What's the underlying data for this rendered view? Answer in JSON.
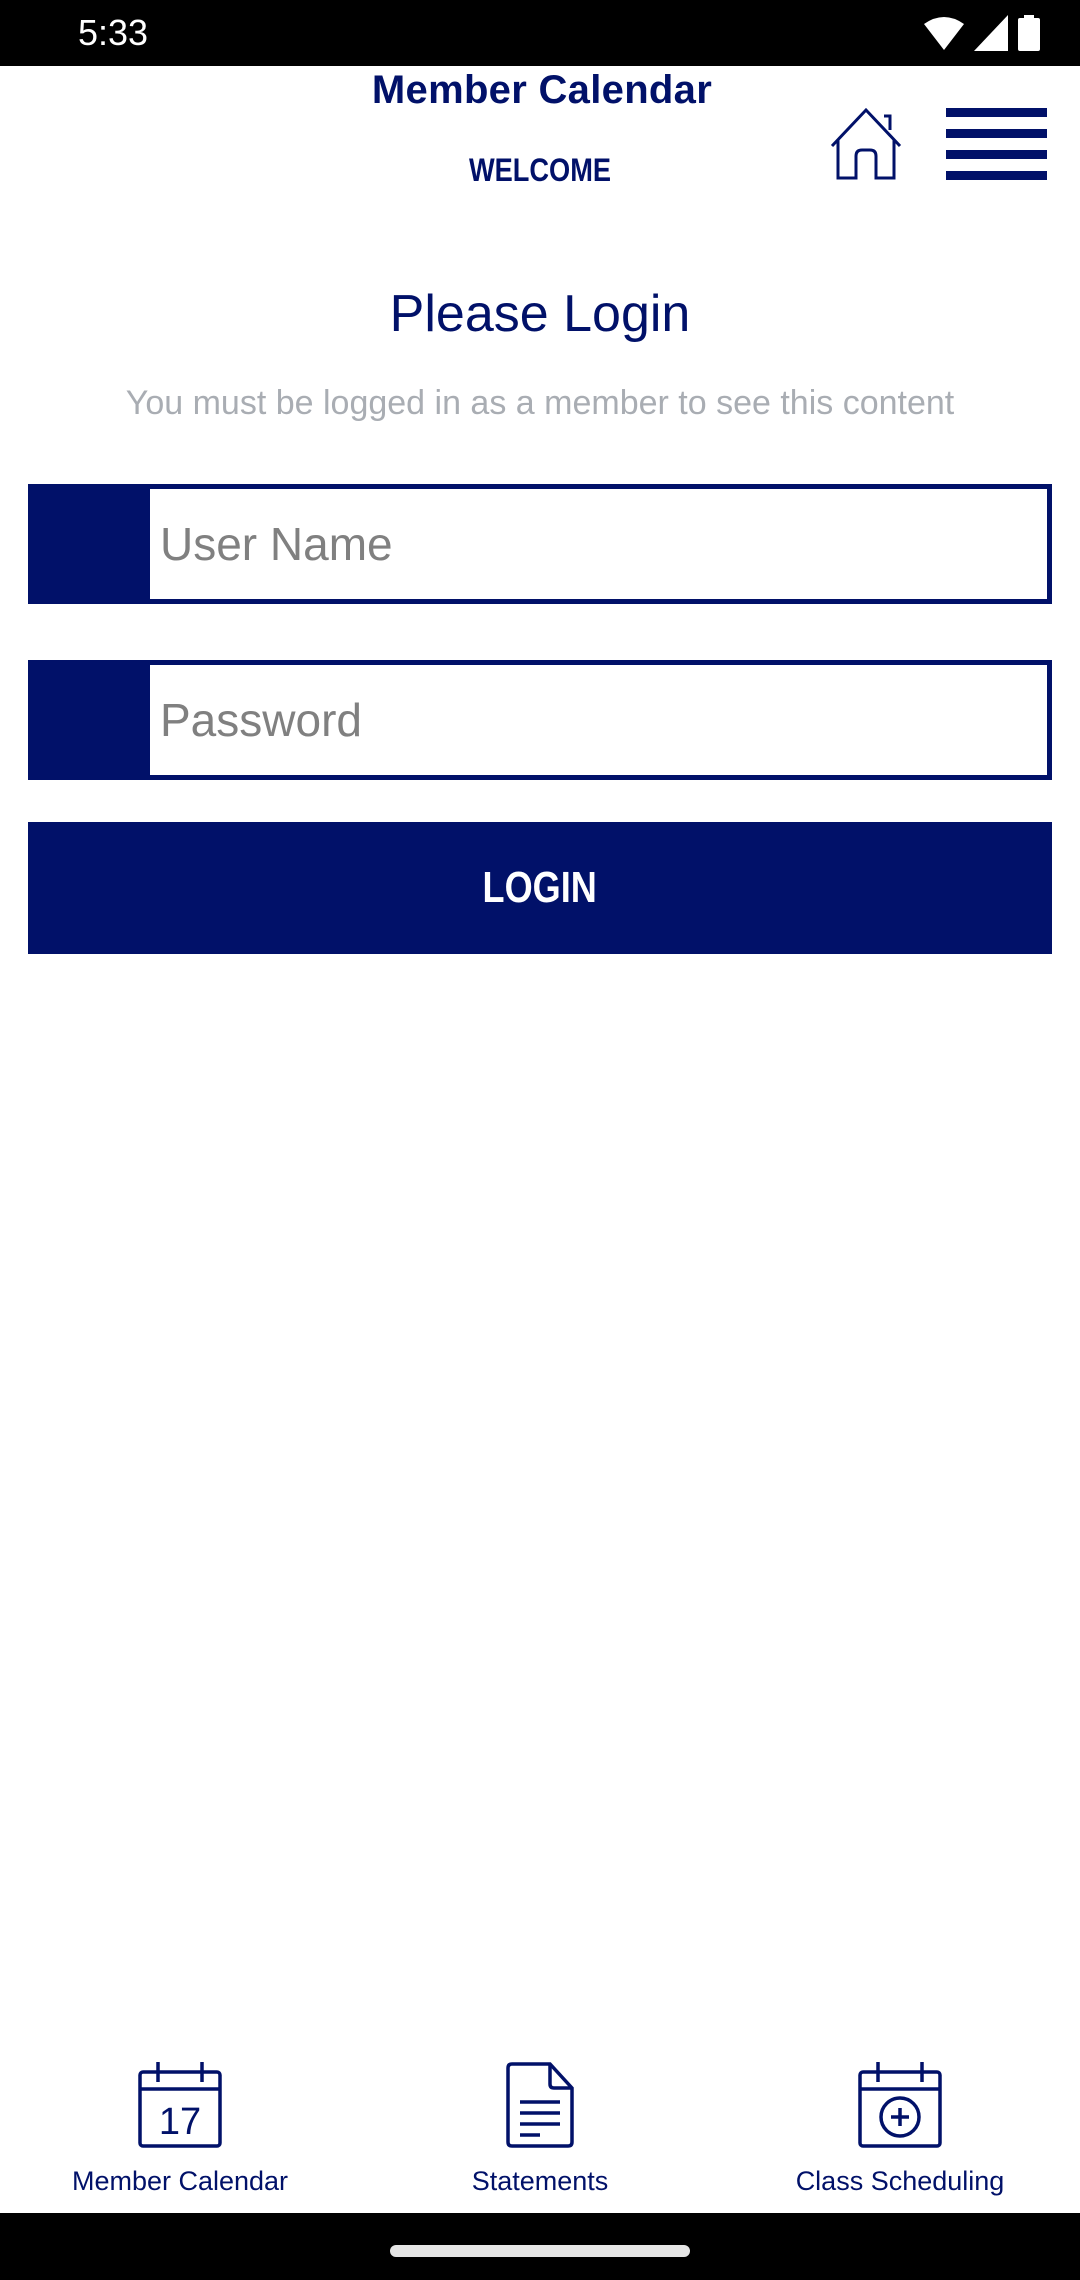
{
  "status_bar": {
    "time": "5:33",
    "icons": [
      "wifi-icon",
      "cellular-signal-icon",
      "battery-icon"
    ]
  },
  "header": {
    "title": "Member Calendar",
    "subtitle": "WELCOME",
    "home_icon": "home-icon",
    "menu_icon": "hamburger-menu-icon"
  },
  "login": {
    "title": "Please Login",
    "subtitle": "You must be logged in as a member to see this content",
    "username": {
      "value": "",
      "placeholder": "User Name"
    },
    "password": {
      "value": "",
      "placeholder": "Password"
    },
    "button_label": "LOGIN"
  },
  "bottom_nav": {
    "items": [
      {
        "label": "Member Calendar",
        "icon": "calendar-17-icon",
        "calendar_day": "17"
      },
      {
        "label": "Statements",
        "icon": "document-icon"
      },
      {
        "label": "Class Scheduling",
        "icon": "calendar-add-icon"
      }
    ]
  },
  "colors": {
    "brand_navy": "#011169",
    "subtitle_gray": "#a9adb3",
    "placeholder_gray": "#808080"
  }
}
